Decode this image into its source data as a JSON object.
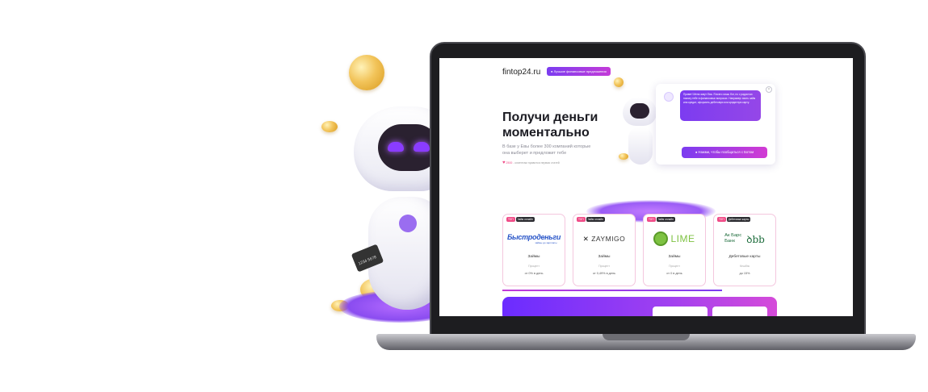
{
  "site": {
    "logo": "fintop24.ru",
    "badge": "Лучшие финансовые предложения"
  },
  "hero": {
    "title": "Получи деньги моментально",
    "subtitle": "В базе у Евы более 300 компаний которые она выберет и предложит тебе",
    "stat_count": "2500",
    "stat_text": "- клиентам нравится первая статей"
  },
  "chat": {
    "message": "Привет! Меня зовут Ева. Я всего лишь бот, но с радостью помогу тебе в финансовых вопросах. Например: взять займ или кредит, оформить дебетовую или кредитную карту.",
    "cta": "Нажми, чтобы пообщаться с Ботом",
    "close": "×"
  },
  "offers": [
    {
      "tags": [
        "ТОП",
        "Займ онлайн"
      ],
      "logo": "Быстроденьги",
      "logo_sub": "займы до зарплаты",
      "title": "Займы",
      "label": "Процент",
      "value": "от 0% в день"
    },
    {
      "tags": [
        "ТОП",
        "Займ онлайн"
      ],
      "logo": "ZAYMIGO",
      "title": "Займы",
      "label": "Процент",
      "value": "от 0,49% в день"
    },
    {
      "tags": [
        "ТОП",
        "Займ онлайн"
      ],
      "logo": "LIME",
      "title": "Займы",
      "label": "Процент",
      "value": "от 0 в день"
    },
    {
      "tags": [
        "ТОП",
        "Дебетовые карты"
      ],
      "logo_line1": "Ак Барс",
      "logo_line2": "Банк",
      "title": "Дебетовые карты",
      "label": "Кешбэк",
      "value": "до 15%"
    }
  ],
  "decor": {
    "card_text": "1234 5678"
  },
  "colors": {
    "accent_purple": "#7b3cf0",
    "accent_pink": "#f04a86",
    "lime_green": "#7ec242",
    "akbars_green": "#1b6b3a"
  }
}
